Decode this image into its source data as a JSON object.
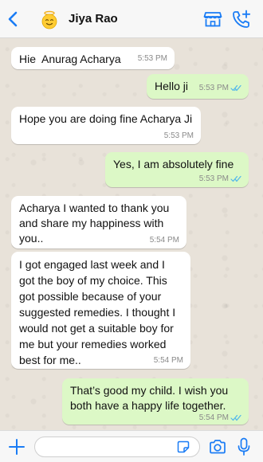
{
  "header": {
    "contact_name": "Jiya Rao",
    "icons": [
      "back-chevron-icon",
      "avatar-emoji",
      "store-icon",
      "add-call-icon"
    ],
    "accent_color": "#1a7cf5"
  },
  "messages": [
    {
      "direction": "incoming",
      "text": "Hie  Anurag Acharya",
      "time": "5:53 PM"
    },
    {
      "direction": "outgoing",
      "text": "Hello ji",
      "time": "5:53 PM",
      "status": "read"
    },
    {
      "direction": "incoming",
      "text": "Hope you are doing fine Acharya Ji",
      "time": "5:53 PM"
    },
    {
      "direction": "outgoing",
      "text": "Yes, I am absolutely fine",
      "time": "5:53 PM",
      "status": "read"
    },
    {
      "direction": "incoming",
      "text": "Acharya I wanted to thank you and share my happiness with you..",
      "time": "5:54 PM"
    },
    {
      "direction": "incoming",
      "text": "I got engaged last week and I got the boy of my choice. This got possible because of your suggested remedies. I thought I would not get a suitable boy for me but your remedies worked best for me..",
      "time": "5:54 PM"
    },
    {
      "direction": "outgoing",
      "text": "That’s good my child. I wish you both have a happy life together.",
      "time": "5:54 PM",
      "status": "read"
    }
  ],
  "composer": {
    "input_value": "",
    "icons": [
      "plus-icon",
      "sticker-icon",
      "camera-icon",
      "microphone-icon"
    ]
  },
  "colors": {
    "incoming_bubble": "#ffffff",
    "outgoing_bubble": "#dcf8c6",
    "read_ticks": "#4fb6ec"
  }
}
